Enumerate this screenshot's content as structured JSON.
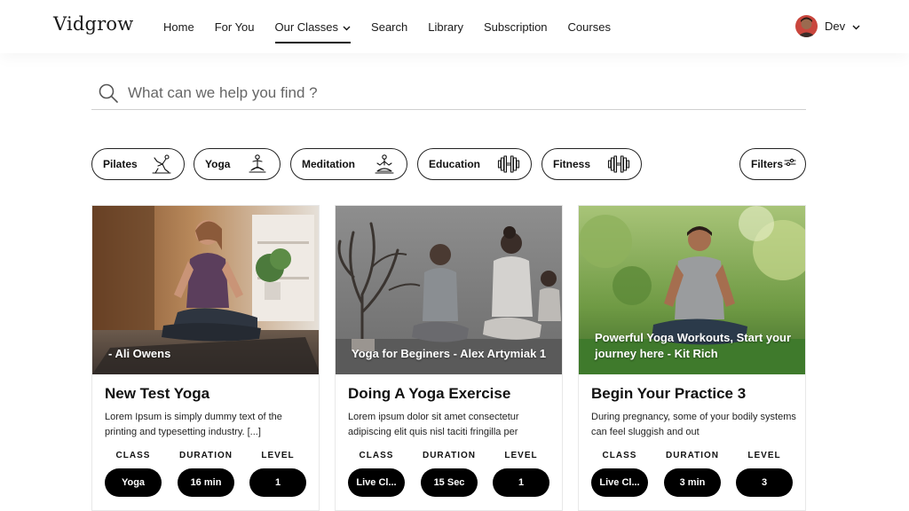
{
  "header": {
    "logo": "Vidgrow",
    "nav": [
      {
        "label": "Home"
      },
      {
        "label": "For You"
      },
      {
        "label": "Our Classes",
        "active": true
      },
      {
        "label": "Search"
      },
      {
        "label": "Library"
      },
      {
        "label": "Subscription"
      },
      {
        "label": "Courses"
      }
    ],
    "user": {
      "name": "Dev"
    }
  },
  "search": {
    "placeholder": "What can we help you find ?"
  },
  "categories": [
    {
      "label": "Pilates",
      "icon": "pilates-icon"
    },
    {
      "label": "Yoga",
      "icon": "yoga-icon"
    },
    {
      "label": "Meditation",
      "icon": "meditation-icon"
    },
    {
      "label": "Education",
      "icon": "dumbbell-icon"
    },
    {
      "label": "Fitness",
      "icon": "dumbbell-icon"
    },
    {
      "label": "Filters",
      "icon": "sliders-icon"
    }
  ],
  "meta_labels": {
    "class": "CLASS",
    "duration": "DURATION",
    "level": "LEVEL"
  },
  "cards": [
    {
      "caption": "- Ali Owens",
      "title": "New Test Yoga",
      "description": "Lorem Ipsum is simply dummy text of the printing and typesetting industry. [...]",
      "class": "Yoga",
      "duration": "16 min",
      "level": "1"
    },
    {
      "caption": "Yoga for Beginers - Alex Artymiak 1",
      "title": "Doing A Yoga Exercise",
      "description": "Lorem ipsum dolor sit amet consectetur adipiscing elit quis nisl taciti fringilla per",
      "class": "Live Cl...",
      "duration": "15 Sec",
      "level": "1"
    },
    {
      "caption": "Powerful Yoga Workouts, Start your journey here - Kit Rich",
      "title": "Begin Your Practice 3",
      "description": "During pregnancy, some of your bodily systems can feel sluggish and out",
      "class": "Live Cl...",
      "duration": "3 min",
      "level": "3"
    }
  ],
  "colors": {
    "accent": "#000000",
    "text": "#111111",
    "border": "#222222"
  }
}
